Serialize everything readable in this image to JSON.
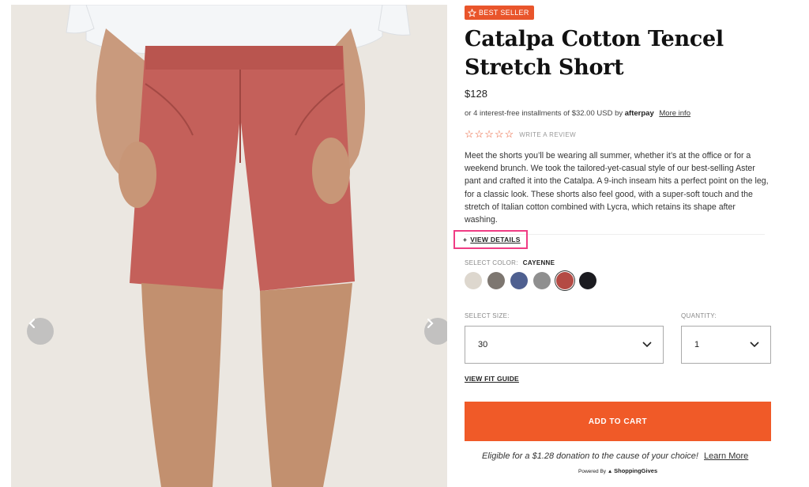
{
  "badge": {
    "label": "BEST SELLER"
  },
  "product": {
    "title": "Catalpa Cotton Tencel Stretch Short",
    "price": "$128",
    "afterpay_text": "or 4 interest-free installments of $32.00 USD by",
    "afterpay_brand": "afterpay",
    "afterpay_more": "More info",
    "rating_stars": "☆☆☆☆☆",
    "write_review": "WRITE A REVIEW",
    "description": "Meet the shorts you’ll be wearing all summer, whether it’s at the office or for a weekend brunch. We took the tailored-yet-casual style of our best-selling Aster pant and crafted it into the Catalpa. A 9-inch inseam hits a perfect point on the leg, for a classic look. These shorts also feel good, with a super-soft touch and the stretch of Italian cotton combined with Lycra, which retains its shape after washing.",
    "view_details": "VIEW DETAILS",
    "view_details_icon": "+"
  },
  "color": {
    "label": "SELECT COLOR:",
    "selected": "CAYENNE",
    "swatches": [
      "#ddd7ce",
      "#7d7670",
      "#4f6090",
      "#8f8f8f",
      "#b44a44",
      "#1b1b20"
    ],
    "selected_index": 4
  },
  "size": {
    "label": "SELECT SIZE:",
    "value": "30"
  },
  "quantity": {
    "label": "QUANTITY:",
    "value": "1"
  },
  "fit_guide": "VIEW FIT GUIDE",
  "cta": {
    "add_to_cart": "ADD TO CART"
  },
  "donation": {
    "text": "Eligible for a $1.28 donation to the cause of your choice!",
    "learn_more": "Learn More",
    "powered_by": "Powered By",
    "brand": "ShoppingGives"
  },
  "colors": {
    "accent": "#f05a28",
    "highlight": "#f03c84",
    "shorts": "#c4605a"
  },
  "icons": {
    "prev": "chevron-left-icon",
    "next": "chevron-right-icon",
    "select": "chevron-down-icon",
    "badge": "star-icon"
  }
}
